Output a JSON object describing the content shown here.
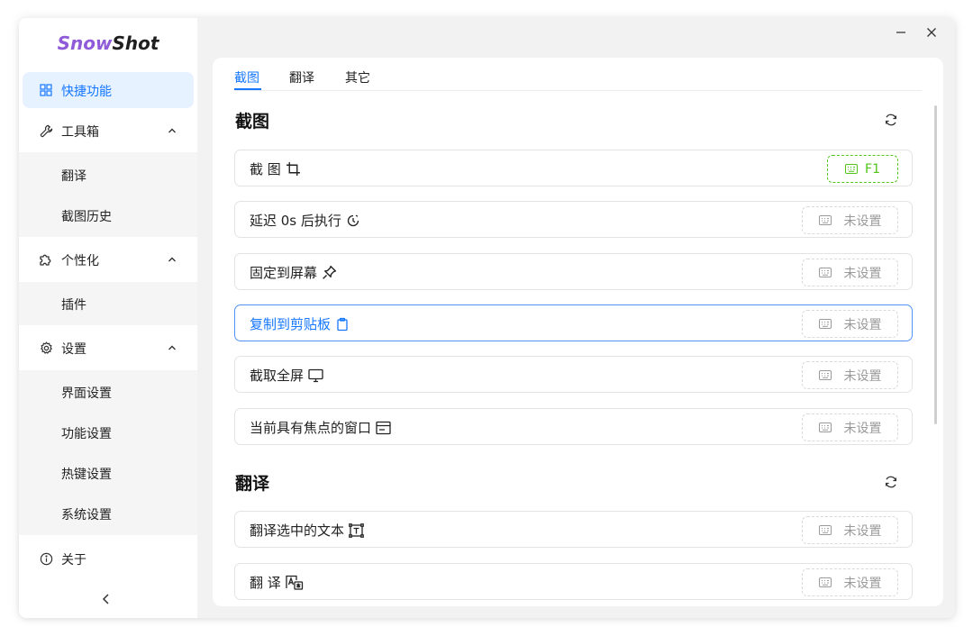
{
  "app": {
    "logo_part1": "Snow",
    "logo_part2": "Shot"
  },
  "sidebar": {
    "items": [
      {
        "label": "快捷功能",
        "icon": "grid-icon",
        "active": true
      },
      {
        "label": "工具箱",
        "icon": "wrench-icon",
        "expanded": true,
        "children": [
          {
            "label": "翻译"
          },
          {
            "label": "截图历史"
          }
        ]
      },
      {
        "label": "个性化",
        "icon": "puzzle-icon",
        "expanded": true,
        "children": [
          {
            "label": "插件"
          }
        ]
      },
      {
        "label": "设置",
        "icon": "gear-icon",
        "expanded": true,
        "children": [
          {
            "label": "界面设置"
          },
          {
            "label": "功能设置"
          },
          {
            "label": "热键设置"
          },
          {
            "label": "系统设置"
          }
        ]
      },
      {
        "label": "关于",
        "icon": "info-icon"
      }
    ]
  },
  "tabs": [
    {
      "label": "截图",
      "active": true
    },
    {
      "label": "翻译"
    },
    {
      "label": "其它"
    }
  ],
  "sections": [
    {
      "title": "截图",
      "rows": [
        {
          "label": "截 图",
          "icon": "crop-icon",
          "hotkey": "F1",
          "hotkey_set": true
        },
        {
          "label": "延迟 0s 后执行",
          "icon": "timer-icon",
          "hotkey": "未设置"
        },
        {
          "label": "固定到屏幕",
          "icon": "pin-icon",
          "hotkey": "未设置"
        },
        {
          "label": "复制到剪贴板",
          "icon": "clipboard-icon",
          "hotkey": "未设置",
          "focused": true
        },
        {
          "label": "截取全屏",
          "icon": "monitor-icon",
          "hotkey": "未设置"
        },
        {
          "label": "当前具有焦点的窗口",
          "icon": "window-icon",
          "hotkey": "未设置"
        }
      ]
    },
    {
      "title": "翻译",
      "rows": [
        {
          "label": "翻译选中的文本",
          "icon": "text-select-icon",
          "hotkey": "未设置"
        },
        {
          "label": "翻 译",
          "icon": "translate-icon",
          "hotkey": "未设置"
        }
      ]
    }
  ],
  "colors": {
    "accent": "#1677ff",
    "active_bg": "#e6f2ff",
    "hotkey_set": "#52c41a",
    "logo_purple": "#8f5bd9"
  }
}
